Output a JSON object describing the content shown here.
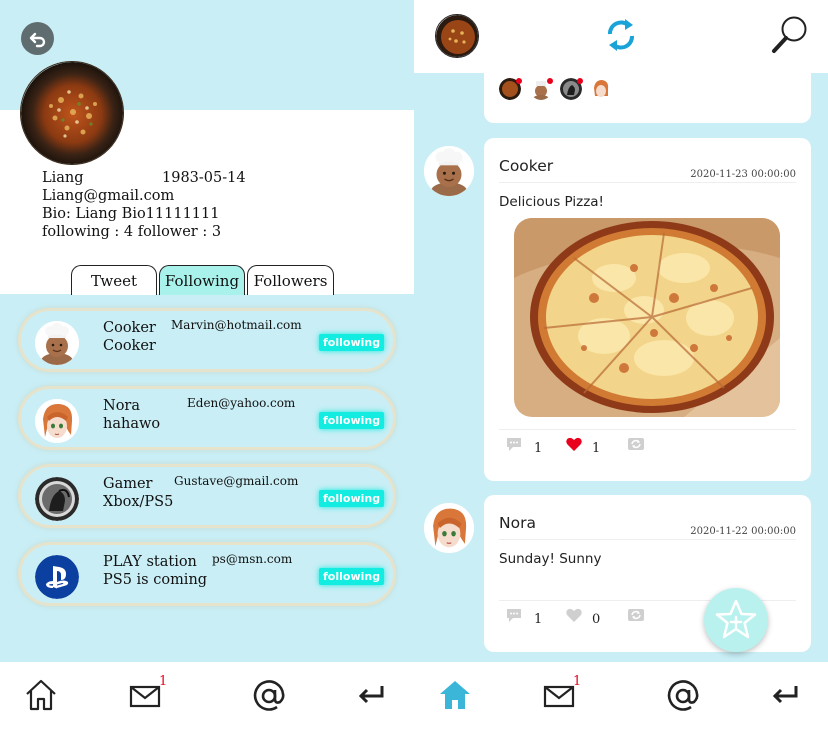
{
  "colors": {
    "background": "#c9eef5",
    "accent": "#13ece0",
    "tab_active": "#a9f2ec",
    "like_red": "#e8001c",
    "home_blue": "#3bb6d9"
  },
  "profile": {
    "name": "Liang",
    "birthdate": "1983-05-14",
    "email": "Liang@gmail.com",
    "bio": "Bio: Liang Bio11111111",
    "stats": "following : 4 follower : 3",
    "tabs": [
      "Tweet",
      "Following",
      "Followers"
    ],
    "active_tab": "Following"
  },
  "following": [
    {
      "name": "Cooker",
      "subtitle": "Cooker",
      "email": "Marvin@hotmail.com",
      "button": "following",
      "icon": "chef-avatar"
    },
    {
      "name": "Nora",
      "subtitle": "hahawo",
      "email": "Eden@yahoo.com",
      "button": "following",
      "icon": "anime-girl-avatar"
    },
    {
      "name": "Gamer",
      "subtitle": "Xbox/PS5",
      "email": "Gustave@gmail.com",
      "button": "following",
      "icon": "gamer-avatar"
    },
    {
      "name": "PLAY station",
      "subtitle": "PS5 is coming",
      "email": "ps@msn.com",
      "button": "following",
      "icon": "playstation-logo-avatar"
    }
  ],
  "feed": {
    "header_icons": [
      "user-avatar",
      "refresh-icon",
      "search-icon"
    ],
    "stories": [
      "food-avatar",
      "chef-avatar",
      "gamer-avatar",
      "anime-girl-avatar"
    ],
    "posts": [
      {
        "author": "Cooker",
        "date": "2020-11-23 00:00:00",
        "text": "Delicious Pizza!",
        "image": "pizza-photo",
        "comments": "1",
        "likes": "1",
        "liked": true
      },
      {
        "author": "Nora",
        "date": "2020-11-22 00:00:00",
        "text": "Sunday! Sunny",
        "comments": "1",
        "likes": "0",
        "liked": false
      }
    ]
  },
  "bottom_nav": {
    "items": [
      "home-icon",
      "mail-icon",
      "at-icon",
      "return-icon"
    ],
    "mail_badge": "1",
    "active_left": "none",
    "active_right": "home-icon"
  }
}
